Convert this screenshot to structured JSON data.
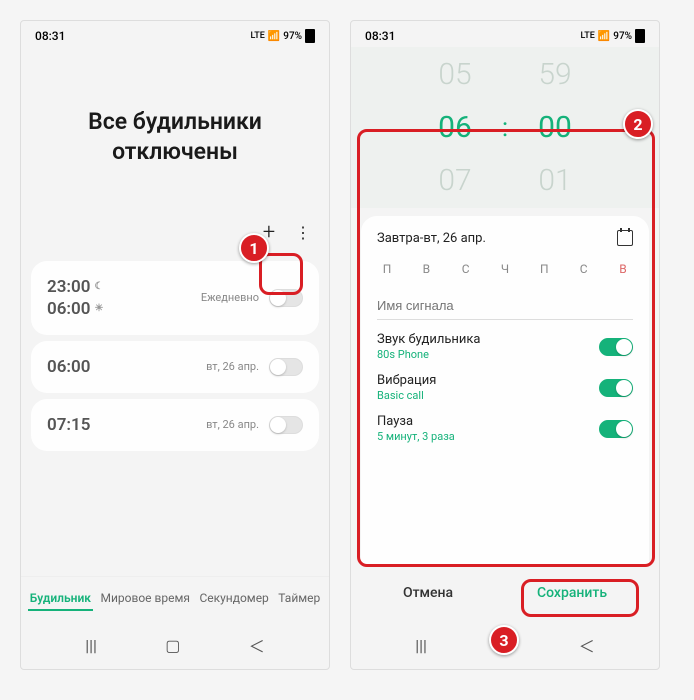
{
  "status": {
    "time": "08:31",
    "net": "LTE",
    "battery": "97%"
  },
  "screen1": {
    "title_line1": "Все будильники",
    "title_line2": "отключены",
    "alarms": [
      {
        "t1": "23:00",
        "i1": "☾",
        "t2": "06:00",
        "i2": "☀",
        "sub": "Ежедневно"
      },
      {
        "t1": "06:00",
        "sub": "вт, 26 апр."
      },
      {
        "t1": "07:15",
        "sub": "вт, 26 апр."
      }
    ],
    "tabs": {
      "alarm": "Будильник",
      "world": "Мировое время",
      "stop": "Секундомер",
      "timer": "Таймер"
    }
  },
  "screen2": {
    "picker": {
      "h_prev": "05",
      "h": "06",
      "h_next": "07",
      "m_prev": "59",
      "m": "00",
      "m_next": "01",
      "colon": ":"
    },
    "date": "Завтра-вт, 26 апр.",
    "days": [
      "П",
      "В",
      "С",
      "Ч",
      "П",
      "С",
      "В"
    ],
    "name_placeholder": "Имя сигнала",
    "sound": {
      "label": "Звук будильника",
      "sub": "80s Phone"
    },
    "vib": {
      "label": "Вибрация",
      "sub": "Basic call"
    },
    "pause": {
      "label": "Пауза",
      "sub": "5 минут, 3 раза"
    },
    "cancel": "Отмена",
    "save": "Сохранить"
  }
}
